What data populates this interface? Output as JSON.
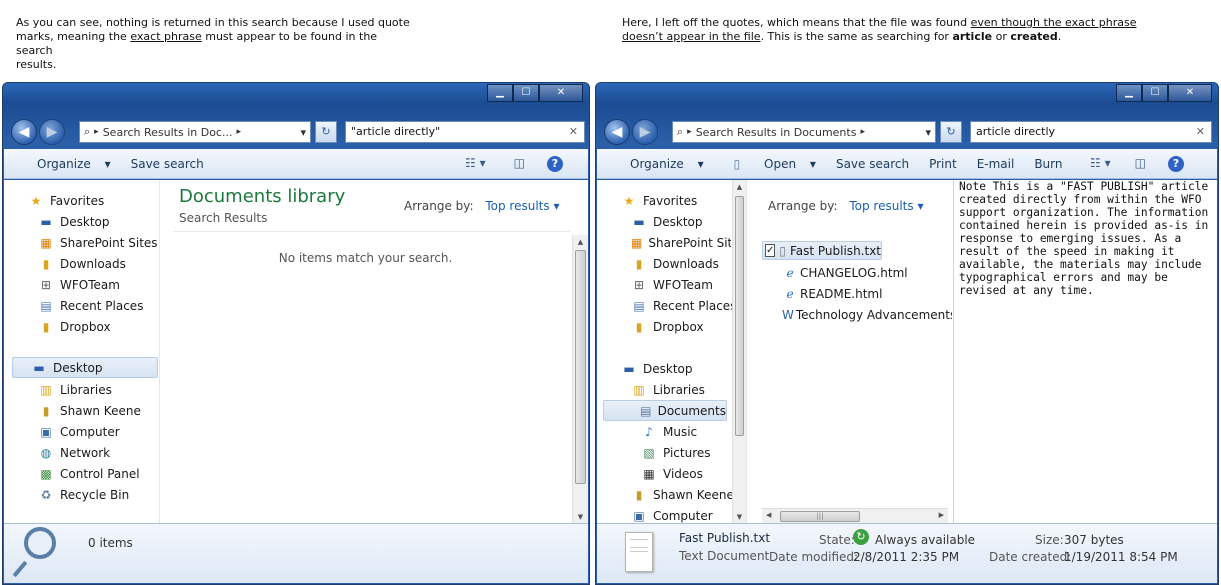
{
  "captions": {
    "left": {
      "l1": "As you can see, nothing is returned in this search because I used quote",
      "l2a": "marks, meaning the ",
      "l2u": "exact phrase",
      "l2b": " must appear to be found in the search",
      "l3": "results."
    },
    "right": {
      "l1a": "Here, I left off the quotes, which means that the file was found ",
      "l1u": "even though the exact phrase",
      "l2u": "doesn’t appear in the file",
      "l2b": ".  This is the same as searching for ",
      "b1": "article",
      "or": " or ",
      "b2": "created",
      "end": "."
    }
  },
  "left": {
    "address": "Search Results in Doc...",
    "search_value": "\"article directly\"",
    "toolbar": {
      "organize": "Organize",
      "save_search": "Save search"
    },
    "nav": {
      "favorites": "Favorites",
      "fav_items": [
        "Desktop",
        "SharePoint Sites",
        "Downloads",
        "WFOTeam",
        "Recent Places",
        "Dropbox"
      ],
      "desktop": "Desktop",
      "items": [
        "Libraries",
        "Shawn Keene",
        "Computer",
        "Network",
        "Control Panel",
        "Recycle Bin"
      ]
    },
    "content": {
      "title": "Documents library",
      "subtitle": "Search Results",
      "arrange_label": "Arrange by:",
      "arrange_value": "Top results",
      "empty": "No items match your search."
    },
    "details": {
      "count": "0 items"
    }
  },
  "right": {
    "address": "Search Results in Documents",
    "search_value": "article directly",
    "toolbar": {
      "organize": "Organize",
      "open": "Open",
      "save_search": "Save search",
      "print": "Print",
      "email": "E-mail",
      "burn": "Burn"
    },
    "nav": {
      "favorites": "Favorites",
      "fav_items": [
        "Desktop",
        "SharePoint Sites",
        "Downloads",
        "WFOTeam",
        "Recent Places",
        "Dropbox"
      ],
      "desktop": "Desktop",
      "libraries": "Libraries",
      "lib_items": [
        "Documents",
        "Music",
        "Pictures",
        "Videos"
      ],
      "items": [
        "Shawn Keene",
        "Computer"
      ]
    },
    "content": {
      "arrange_label": "Arrange by:",
      "arrange_value": "Top results",
      "files": [
        "Fast Publish.txt",
        "CHANGELOG.html",
        "README.html",
        "Technology Advancements.doc"
      ]
    },
    "preview": "Note This is a \"FAST PUBLISH\" article created directly from within the WFO support organization. The information contained herein is provided as-is in response to emerging issues. As a result of the speed in making it available, the materials may include typographical errors and may be revised at any time.",
    "details": {
      "name": "Fast Publish.txt",
      "type": "Text Document",
      "state_label": "State:",
      "state_value": "Always available",
      "modified_label": "Date modified:",
      "modified_value": "2/8/2011 2:35 PM",
      "size_label": "Size:",
      "size_value": "307 bytes",
      "created_label": "Date created:",
      "created_value": "1/19/2011 8:54 PM"
    }
  }
}
